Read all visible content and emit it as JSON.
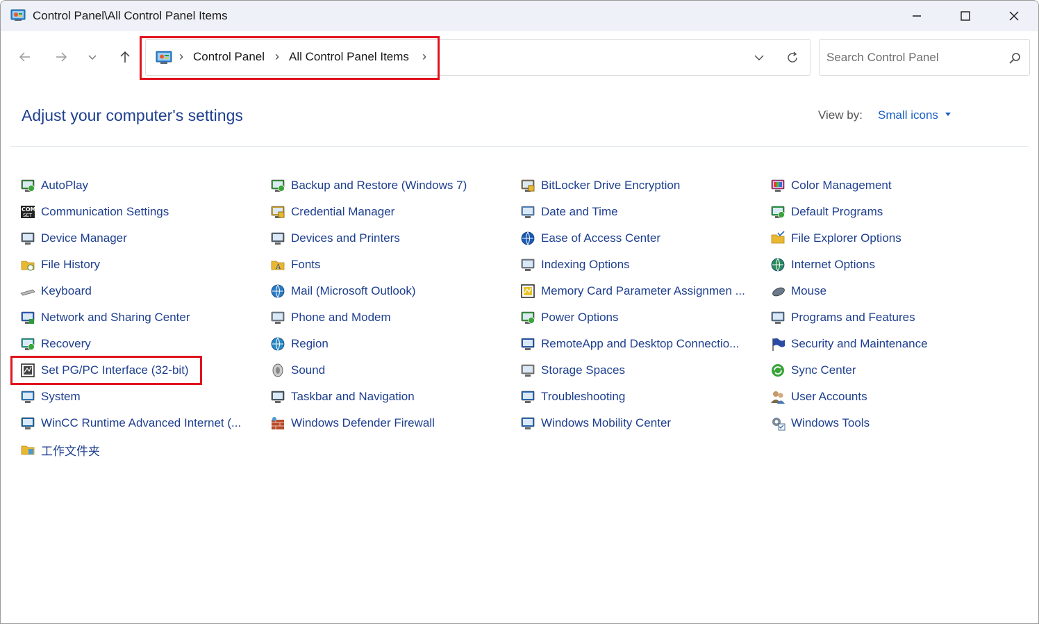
{
  "window": {
    "title": "Control Panel\\All Control Panel Items"
  },
  "address": {
    "crumbs": [
      "Control Panel",
      "All Control Panel Items"
    ]
  },
  "search": {
    "placeholder": "Search Control Panel"
  },
  "header": {
    "title": "Adjust your computer's settings",
    "view_by_label": "View by:",
    "view_by_value": "Small icons"
  },
  "colors": {
    "link": "#1e3f8f",
    "highlight": "#e0141e",
    "accent": "#1a5fc4"
  },
  "columns": [
    [
      {
        "label": "AutoPlay",
        "icon": "autoplay-icon",
        "color": "#3a8a3a"
      },
      {
        "label": "Communication Settings",
        "icon": "com-settings-icon",
        "color": "#222222"
      },
      {
        "label": "Device Manager",
        "icon": "device-manager-icon",
        "color": "#5a6a7a"
      },
      {
        "label": "File History",
        "icon": "file-history-icon",
        "color": "#e8b830"
      },
      {
        "label": "Keyboard",
        "icon": "keyboard-icon",
        "color": "#8a8a8a"
      },
      {
        "label": "Network and Sharing Center",
        "icon": "network-icon",
        "color": "#2a5ec4"
      },
      {
        "label": "Recovery",
        "icon": "recovery-icon",
        "color": "#2a9a8a"
      },
      {
        "label": "Set PG/PC Interface (32-bit)",
        "icon": "pgpc-interface-icon",
        "color": "#333333"
      },
      {
        "label": "System",
        "icon": "system-icon",
        "color": "#2a7ac4"
      },
      {
        "label": "WinCC Runtime Advanced Internet (...",
        "icon": "wincc-icon",
        "color": "#1a6aa4"
      },
      {
        "label": "工作文件夹",
        "icon": "work-folders-icon",
        "color": "#e8b830"
      }
    ],
    [
      {
        "label": "Backup and Restore (Windows 7)",
        "icon": "backup-icon",
        "color": "#3a9a3a"
      },
      {
        "label": "Credential Manager",
        "icon": "credential-icon",
        "color": "#c49a2a"
      },
      {
        "label": "Devices and Printers",
        "icon": "printer-icon",
        "color": "#5a6a7a"
      },
      {
        "label": "Fonts",
        "icon": "fonts-icon",
        "color": "#e8b830"
      },
      {
        "label": "Mail (Microsoft Outlook)",
        "icon": "mail-icon",
        "color": "#2a7ac4"
      },
      {
        "label": "Phone and Modem",
        "icon": "phone-modem-icon",
        "color": "#7a8a9a"
      },
      {
        "label": "Region",
        "icon": "region-icon",
        "color": "#2a8ac4"
      },
      {
        "label": "Sound",
        "icon": "sound-icon",
        "color": "#8a8a8a"
      },
      {
        "label": "Taskbar and Navigation",
        "icon": "taskbar-icon",
        "color": "#4a5a6a"
      },
      {
        "label": "Windows Defender Firewall",
        "icon": "firewall-icon",
        "color": "#b84a2a"
      }
    ],
    [
      {
        "label": "BitLocker Drive Encryption",
        "icon": "bitlocker-icon",
        "color": "#8a7a5a"
      },
      {
        "label": "Date and Time",
        "icon": "date-time-icon",
        "color": "#5a8ac4"
      },
      {
        "label": "Ease of Access Center",
        "icon": "ease-access-icon",
        "color": "#1a5ab4"
      },
      {
        "label": "Indexing Options",
        "icon": "indexing-icon",
        "color": "#7a8a9a"
      },
      {
        "label": "Memory Card Parameter Assignmen ...",
        "icon": "memory-card-icon",
        "color": "#222222"
      },
      {
        "label": "Power Options",
        "icon": "power-icon",
        "color": "#3a9a3a"
      },
      {
        "label": "RemoteApp and Desktop Connectio...",
        "icon": "remoteapp-icon",
        "color": "#2a5ab4"
      },
      {
        "label": "Storage Spaces",
        "icon": "storage-icon",
        "color": "#8a8a8a"
      },
      {
        "label": "Troubleshooting",
        "icon": "troubleshooting-icon",
        "color": "#2a6ab4"
      },
      {
        "label": "Windows Mobility Center",
        "icon": "mobility-icon",
        "color": "#2a6ab4"
      }
    ],
    [
      {
        "label": "Color Management",
        "icon": "color-management-icon",
        "color": "#c43a8a"
      },
      {
        "label": "Default Programs",
        "icon": "default-programs-icon",
        "color": "#2a9a4a"
      },
      {
        "label": "File Explorer Options",
        "icon": "file-explorer-options-icon",
        "color": "#e8b830"
      },
      {
        "label": "Internet Options",
        "icon": "internet-options-icon",
        "color": "#2a8a5a"
      },
      {
        "label": "Mouse",
        "icon": "mouse-icon",
        "color": "#5a6a7a"
      },
      {
        "label": "Programs and Features",
        "icon": "programs-features-icon",
        "color": "#5a7a9a"
      },
      {
        "label": "Security and Maintenance",
        "icon": "security-flag-icon",
        "color": "#2a4aa4"
      },
      {
        "label": "Sync Center",
        "icon": "sync-center-icon",
        "color": "#3aa43a"
      },
      {
        "label": "User Accounts",
        "icon": "user-accounts-icon",
        "color": "#7a6a4a"
      },
      {
        "label": "Windows Tools",
        "icon": "windows-tools-icon",
        "color": "#7a8a9a"
      }
    ]
  ]
}
